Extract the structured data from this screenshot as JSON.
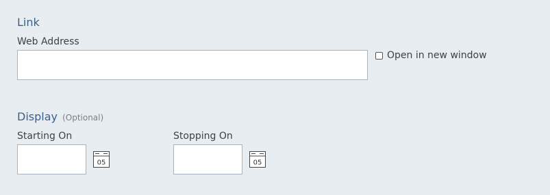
{
  "link_section": {
    "title": "Link",
    "web_address_label": "Web Address",
    "web_address_value": "",
    "open_new_window_label": "Open in new window",
    "open_new_window_checked": false
  },
  "display_section": {
    "title": "Display",
    "optional_label": "(Optional)",
    "starting_on_label": "Starting On",
    "starting_on_value": "",
    "stopping_on_label": "Stopping On",
    "stopping_on_value": "",
    "calendar_icon_text": "05"
  },
  "icons": {
    "calendar": "calendar-icon",
    "checkbox": "checkbox-unchecked"
  }
}
